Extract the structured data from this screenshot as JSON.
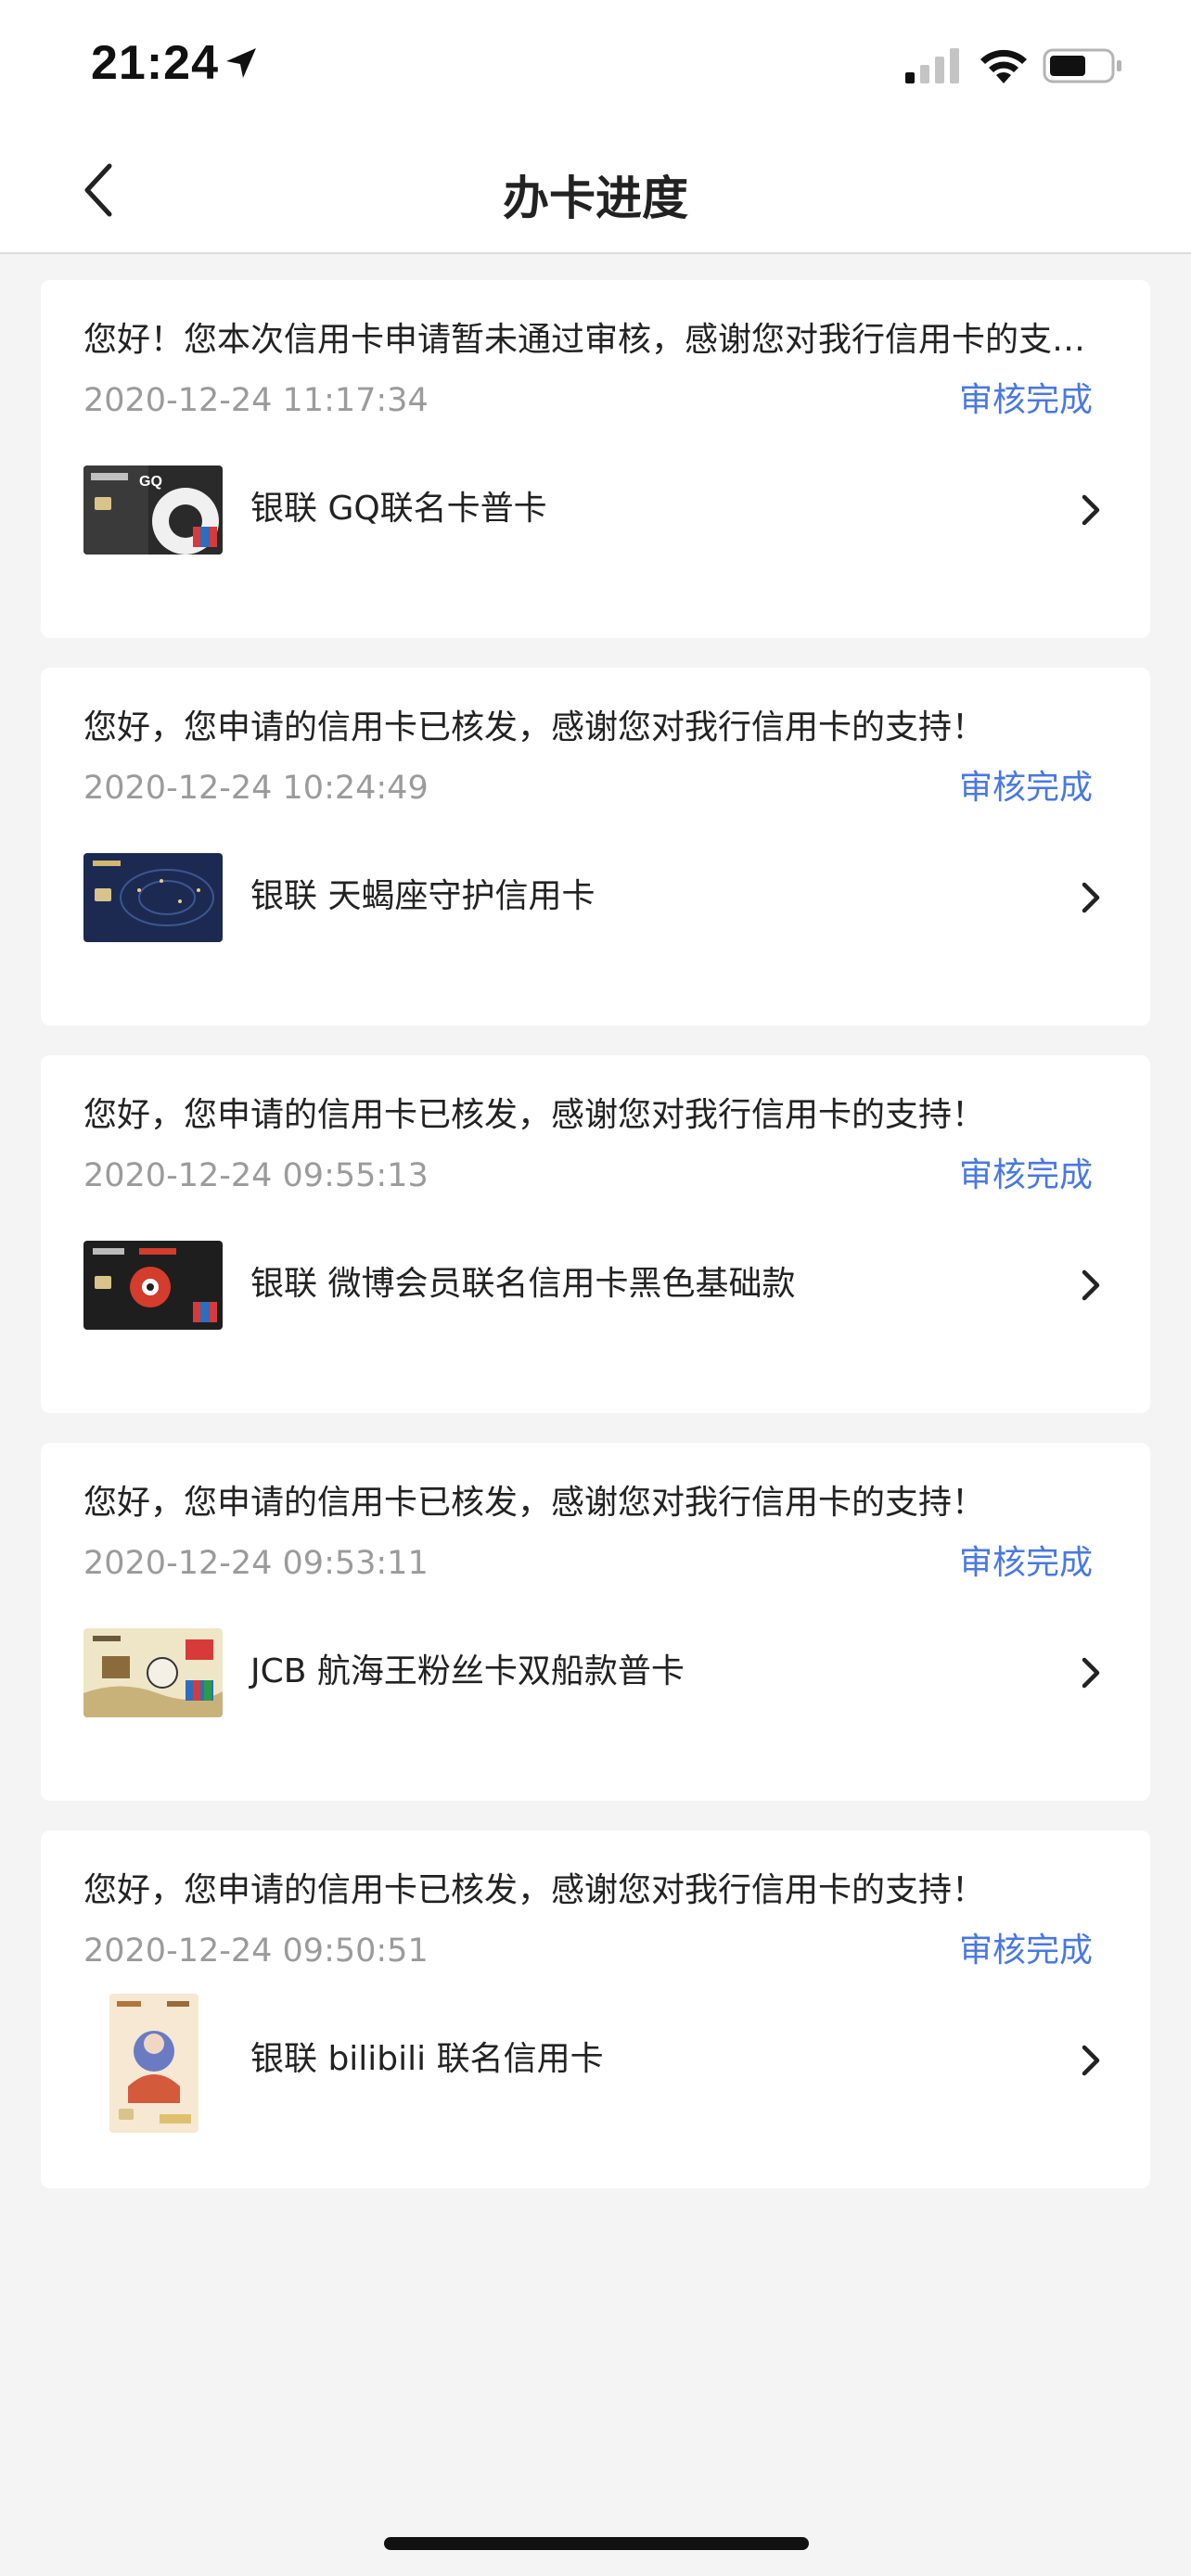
{
  "status_bar": {
    "time": "21:24"
  },
  "nav": {
    "title": "办卡进度"
  },
  "cards": [
    {
      "message": "您好！您本次信用卡申请暂未通过审核，感谢您对我行信用卡的支持！",
      "timestamp": "2020-12-24 11:17:34",
      "status": "审核完成",
      "card_name": "银联 GQ联名卡普卡"
    },
    {
      "message": "您好，您申请的信用卡已核发，感谢您对我行信用卡的支持！",
      "timestamp": "2020-12-24 10:24:49",
      "status": "审核完成",
      "card_name": "银联 天蝎座守护信用卡"
    },
    {
      "message": "您好，您申请的信用卡已核发，感谢您对我行信用卡的支持！",
      "timestamp": "2020-12-24 09:55:13",
      "status": "审核完成",
      "card_name": "银联 微博会员联名信用卡黑色基础款"
    },
    {
      "message": "您好，您申请的信用卡已核发，感谢您对我行信用卡的支持！",
      "timestamp": "2020-12-24 09:53:11",
      "status": "审核完成",
      "card_name": "JCB 航海王粉丝卡双船款普卡"
    },
    {
      "message": "您好，您申请的信用卡已核发，感谢您对我行信用卡的支持！",
      "timestamp": "2020-12-24 09:50:51",
      "status": "审核完成",
      "card_name": "银联 bilibili 联名信用卡"
    }
  ],
  "colors": {
    "accent": "#4a78e0",
    "muted": "#9b9b9b",
    "background": "#f4f4f5"
  }
}
